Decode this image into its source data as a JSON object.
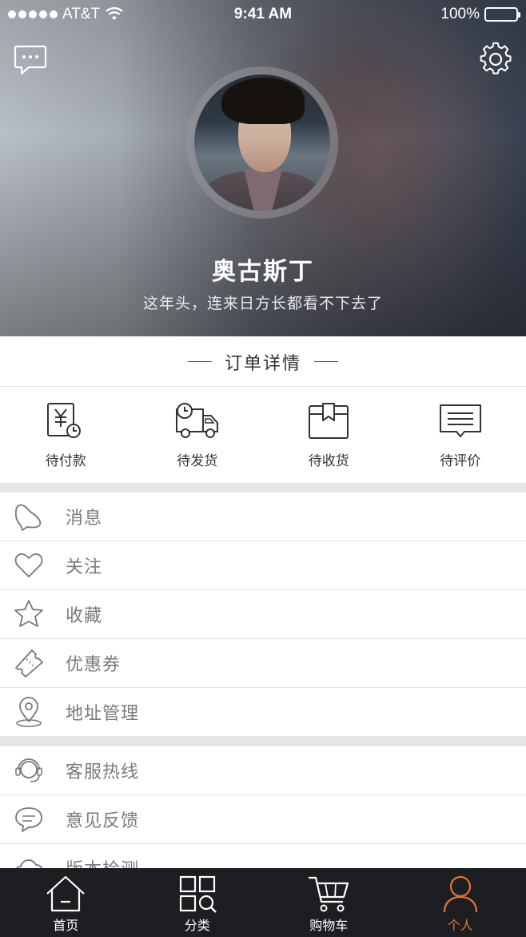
{
  "status_bar": {
    "carrier": "AT&T",
    "time": "9:41 AM",
    "battery": "100%"
  },
  "header": {
    "message_icon": "chat-bubble-icon",
    "settings_icon": "gear-icon"
  },
  "profile": {
    "name": "奥古斯丁",
    "bio": "这年头，连来日方长都看不下去了"
  },
  "orders": {
    "title": "订单详情",
    "items": [
      {
        "label": "待付款",
        "icon": "payment-pending-icon"
      },
      {
        "label": "待发货",
        "icon": "delivery-truck-icon"
      },
      {
        "label": "待收货",
        "icon": "package-box-icon"
      },
      {
        "label": "待评价",
        "icon": "review-comment-icon"
      }
    ]
  },
  "menu_group_1": [
    {
      "label": "消息",
      "icon": "bell-icon"
    },
    {
      "label": "关注",
      "icon": "heart-icon"
    },
    {
      "label": "收藏",
      "icon": "star-icon"
    },
    {
      "label": "优惠券",
      "icon": "coupon-icon"
    },
    {
      "label": "地址管理",
      "icon": "location-pin-icon"
    }
  ],
  "menu_group_2": [
    {
      "label": "客服热线",
      "icon": "headset-icon"
    },
    {
      "label": "意见反馈",
      "icon": "feedback-icon"
    },
    {
      "label": "版本检测",
      "icon": "cloud-icon"
    }
  ],
  "tabbar": {
    "active_color": "#e8732f",
    "items": [
      {
        "label": "首页",
        "icon": "home-icon"
      },
      {
        "label": "分类",
        "icon": "category-grid-icon"
      },
      {
        "label": "购物车",
        "icon": "cart-icon"
      },
      {
        "label": "个人",
        "icon": "person-icon",
        "active": true
      }
    ]
  }
}
